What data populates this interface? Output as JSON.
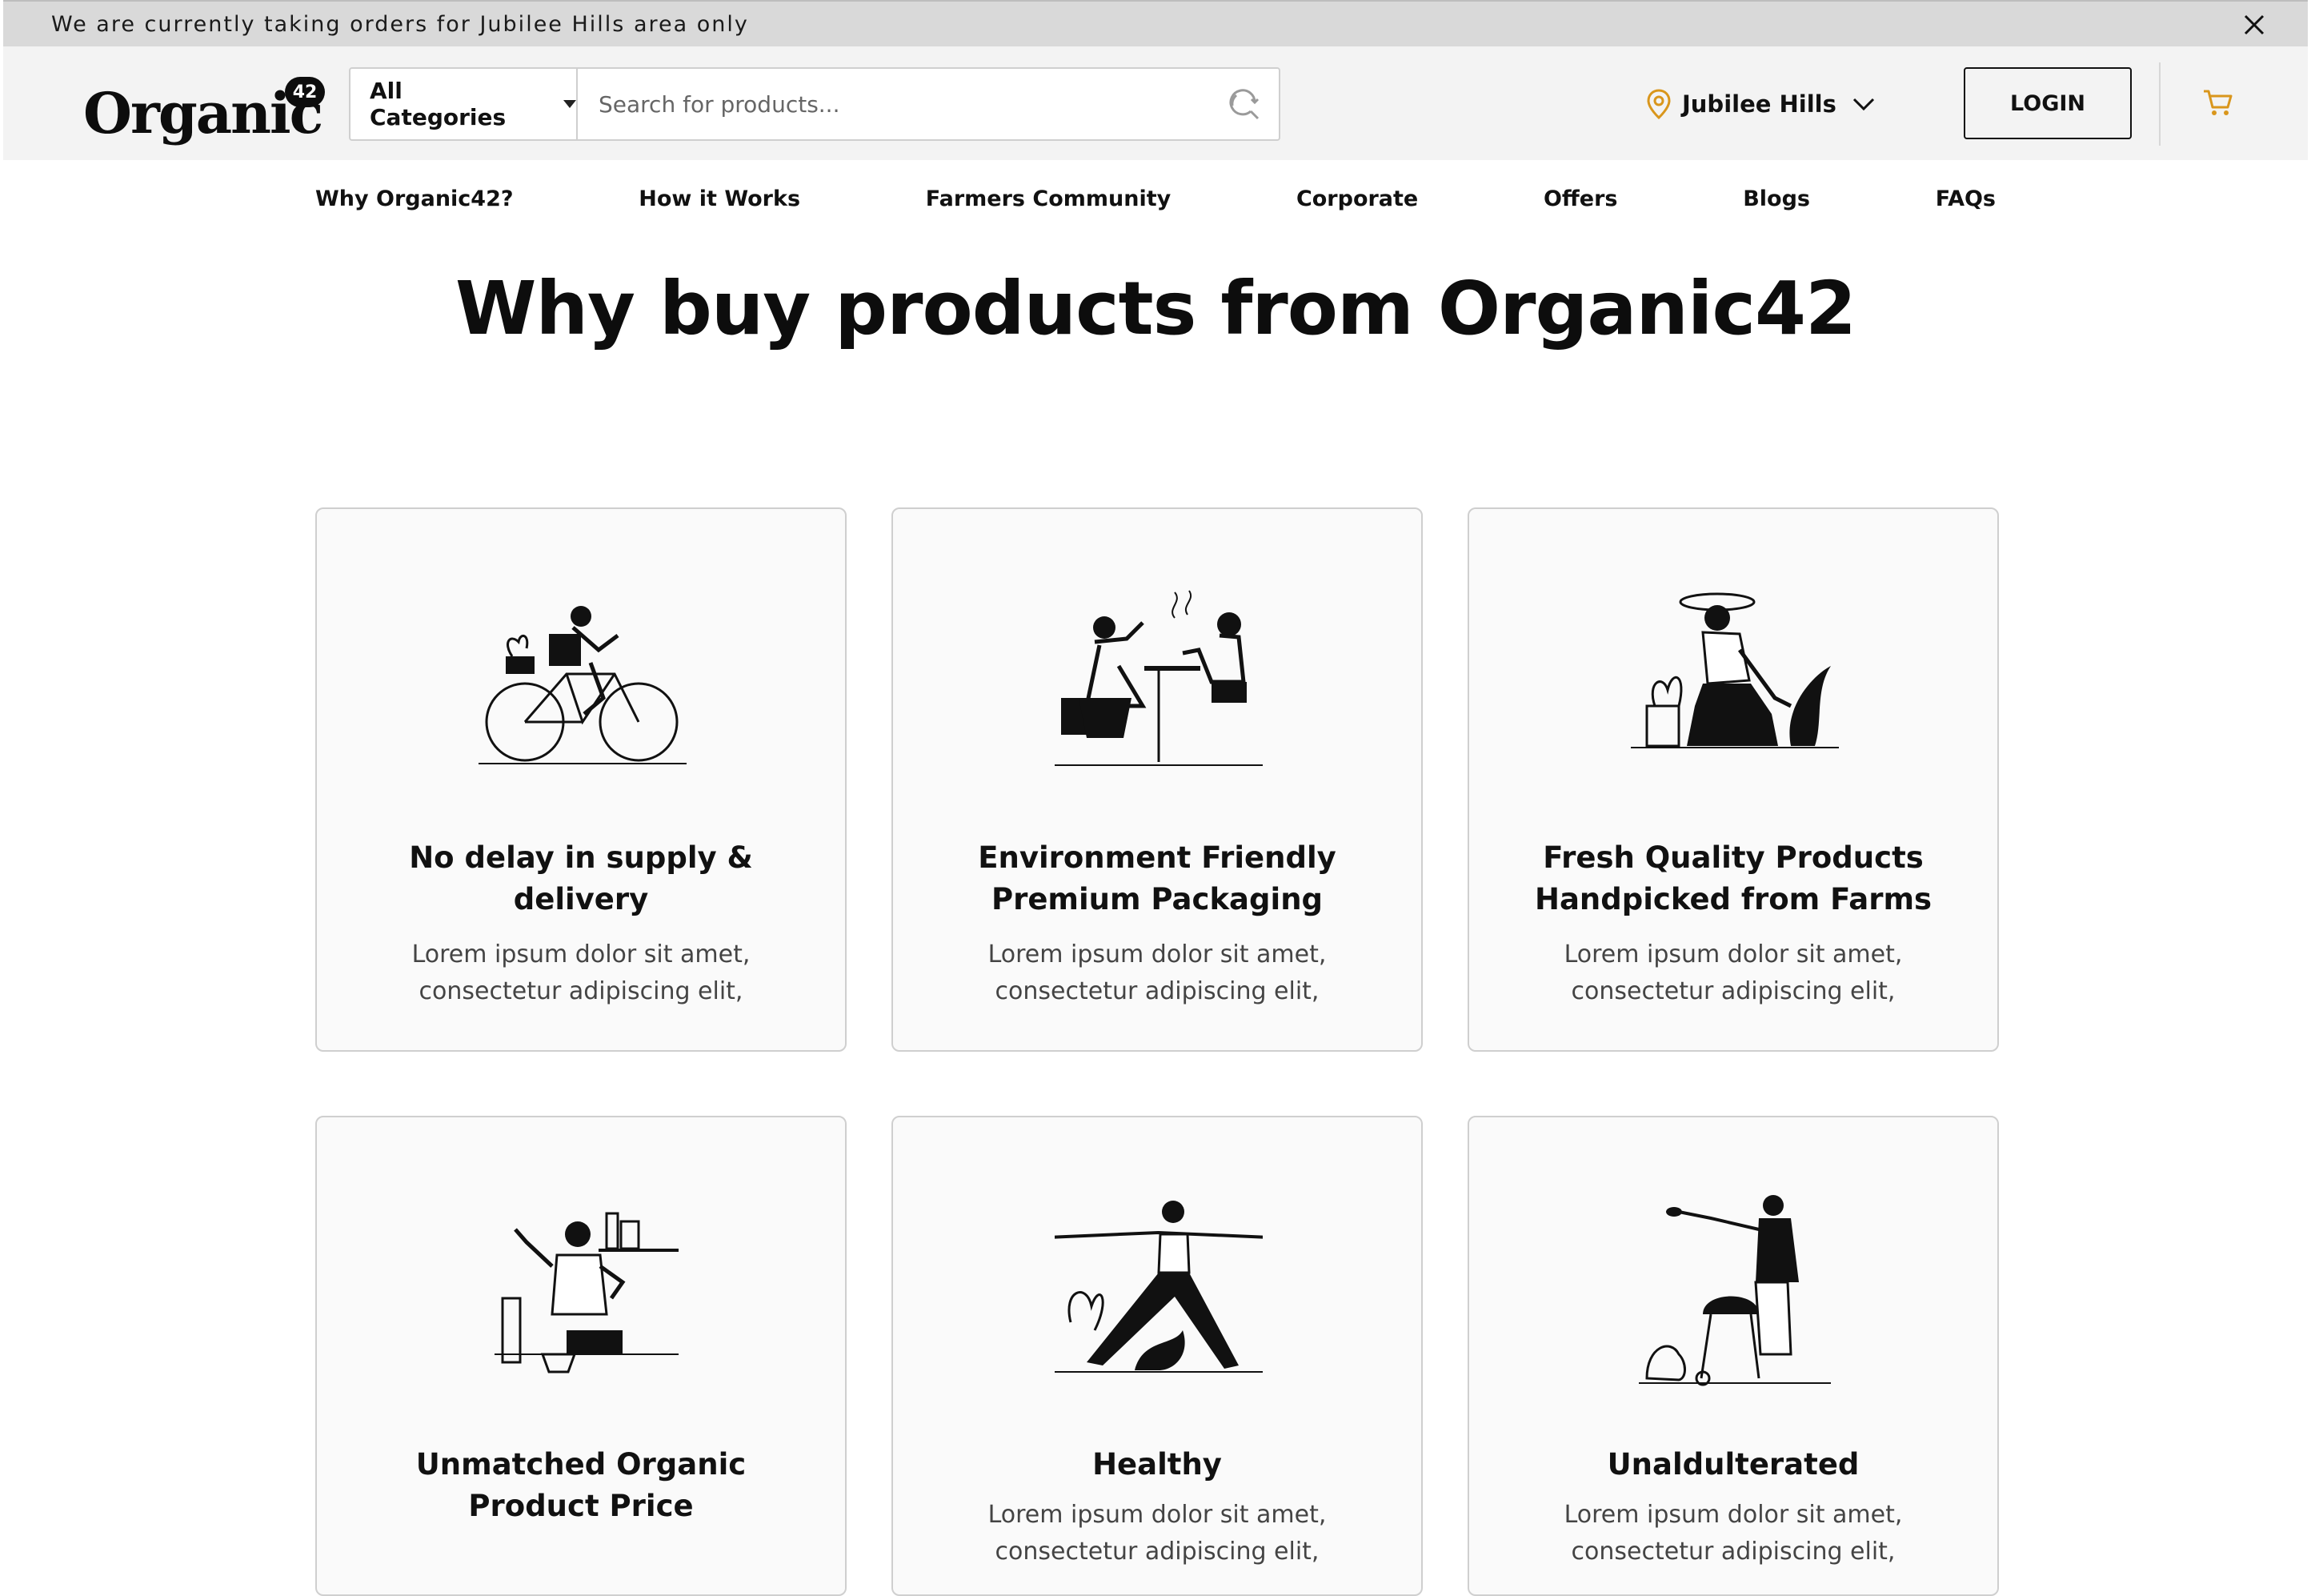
{
  "announcement": {
    "text": "We are currently taking orders for Jubilee Hills area only",
    "close_icon": "close-icon"
  },
  "header": {
    "logo": "Organic42",
    "categories_label": "All Categories",
    "search_placeholder": "Search for products...",
    "location": "Jubilee Hills",
    "login_label": "LOGIN",
    "icons": [
      "search-icon",
      "location-pin-icon",
      "chevron-down-icon",
      "cart-icon"
    ],
    "accent_color": "#e0a020"
  },
  "nav": [
    "Why Organic42?",
    "How it Works",
    "Farmers Community",
    "Corporate",
    "Offers",
    "Blogs",
    "FAQs"
  ],
  "section": {
    "heading": "Why buy products from Organic42",
    "cards": [
      {
        "title": "No delay in supply & delivery",
        "description": "Lorem ipsum dolor sit amet, consectetur adipiscing elit,",
        "illustration": "person-on-bicycle"
      },
      {
        "title": "Environment Friendly Premium Packaging",
        "description": "Lorem ipsum dolor sit amet, consectetur adipiscing elit,",
        "illustration": "people-at-cafe-table"
      },
      {
        "title": "Fresh Quality Products Handpicked from Farms",
        "description": "Lorem ipsum dolor sit amet, consectetur adipiscing elit,",
        "illustration": "person-gardening"
      },
      {
        "title": "Unmatched Organic Product Price",
        "description": "",
        "illustration": "person-cooking"
      },
      {
        "title": "Healthy",
        "description": "Lorem ipsum dolor sit amet, consectetur adipiscing elit,",
        "illustration": "person-doing-yoga"
      },
      {
        "title": "Unaldulterated",
        "description": "Lorem ipsum dolor sit amet, consectetur adipiscing elit,",
        "illustration": "person-grilling"
      }
    ]
  }
}
